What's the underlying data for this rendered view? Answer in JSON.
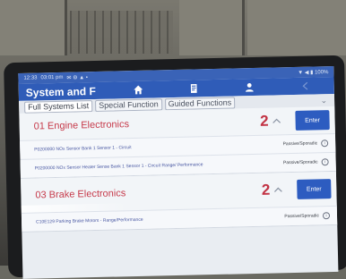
{
  "statusbar": {
    "time": "12:33",
    "date": "03:01 pm",
    "icons": "✉ ⚙ ▲ •",
    "right": "▼ ◀ ▮ 100%"
  },
  "appbar": {
    "title": "System and F",
    "nav": [
      {
        "name": "home-icon"
      },
      {
        "name": "report-icon"
      },
      {
        "name": "person-icon"
      },
      {
        "name": "back-icon"
      }
    ]
  },
  "tabs": [
    "Full Systems List",
    "Special Function",
    "Guided Functions"
  ],
  "sections": [
    {
      "title": "01 Engine Electronics",
      "count": "2",
      "enter_label": "Enter",
      "dtcs": [
        {
          "desc": "P0200000 NOx Sensor Bank 1 Sensor 1 - Circuit",
          "status": "Passive/Sporadic"
        },
        {
          "desc": "P0200000 NOx Sensor Heater Sense Bank 1 Sensor 1 - Circuit Range/ Performance",
          "status": "Passive/Sporadic"
        }
      ]
    },
    {
      "title": "03 Brake Electronics",
      "count": "2",
      "enter_label": "Enter",
      "dtcs": [
        {
          "desc": "C10E129 Parking Brake Motors - Range/Performance",
          "status": "Passive/Sporadic"
        }
      ]
    }
  ],
  "colors": {
    "accent": "#2f5cb8",
    "section_title": "#c63a4a",
    "dtc_text": "#4a59a3"
  }
}
